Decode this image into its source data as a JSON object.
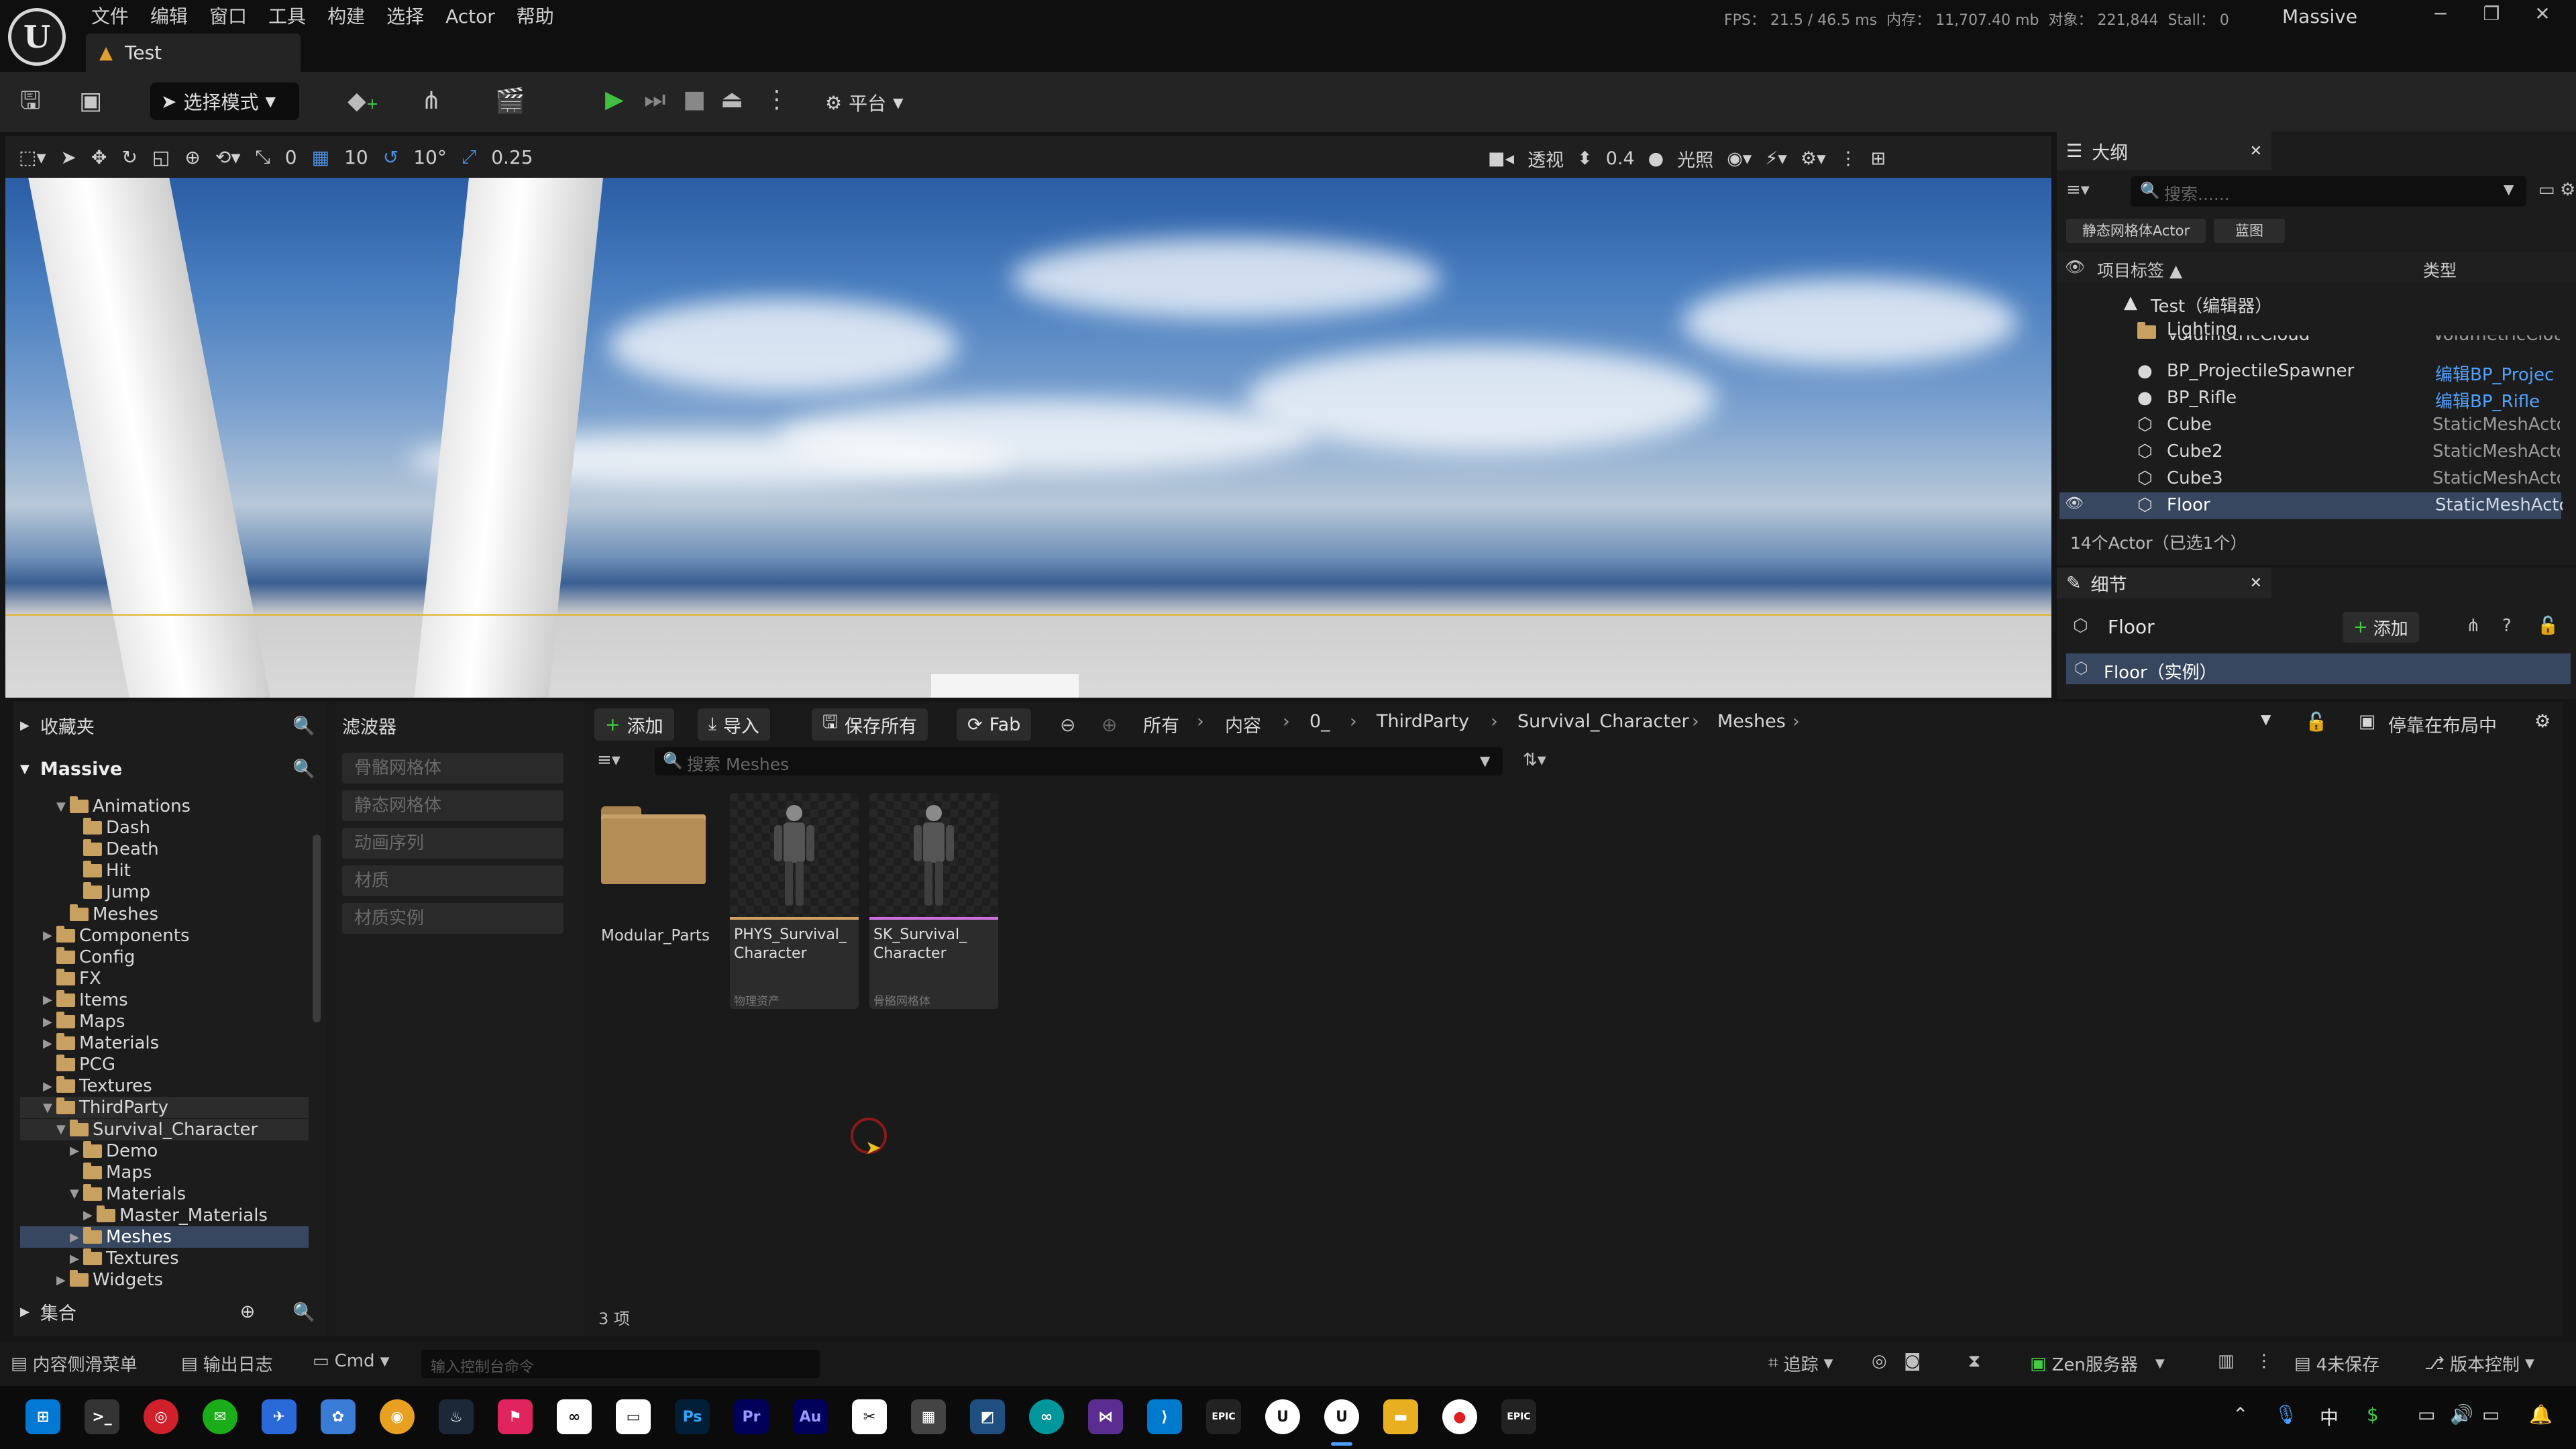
{
  "menu": [
    "文件",
    "编辑",
    "窗口",
    "工具",
    "构建",
    "选择",
    "Actor",
    "帮助"
  ],
  "stats": {
    "fps_label": "FPS：",
    "fps": "21.5",
    "ms": "/ 46.5 ms",
    "mem_label": "内存：",
    "mem": "11,707.40 mb",
    "obj_label": "对象：",
    "obj": "221,844",
    "stall_label": "Stall：",
    "stall": "0"
  },
  "project_name": "Massive",
  "doc_tab": "Test",
  "toolbar": {
    "mode": "选择模式",
    "platform": "平台"
  },
  "vp_toolbar": {
    "snap_move": "0",
    "grid": "10",
    "rot": "10°",
    "scale": "0.25",
    "view": "透视",
    "cam_speed": "0.4",
    "lit": "光照"
  },
  "outliner": {
    "title": "大纲",
    "search_placeholder": "搜索......",
    "filter_chips": [
      "静态网格体Actor",
      "蓝图"
    ],
    "col_label": "项目标签 ▲",
    "col_type": "类型",
    "rows": [
      {
        "name": "Test（编辑器）",
        "type": ""
      },
      {
        "name": "Lighting",
        "type": ""
      },
      {
        "name": "VolumetricCloud",
        "type": "VolumetricCloud"
      },
      {
        "name": "BP_ProjectileSpawner",
        "type": "编辑BP_Projec"
      },
      {
        "name": "BP_Rifle",
        "type": "编辑BP_Rifle"
      },
      {
        "name": "Cube",
        "type": "StaticMeshActo"
      },
      {
        "name": "Cube2",
        "type": "StaticMeshActo"
      },
      {
        "name": "Cube3",
        "type": "StaticMeshActo"
      },
      {
        "name": "Floor",
        "type": "StaticMeshActo"
      }
    ],
    "footer": "14个Actor（已选1个）"
  },
  "details": {
    "title": "细节",
    "actor": "Floor",
    "add": "添加",
    "instance": "Floor（实例）"
  },
  "sources": {
    "favorites": "收藏夹",
    "project": "Massive",
    "tree": [
      {
        "label": "Animations",
        "depth": 2,
        "arrow": "▼"
      },
      {
        "label": "Dash",
        "depth": 3,
        "arrow": ""
      },
      {
        "label": "Death",
        "depth": 3,
        "arrow": ""
      },
      {
        "label": "Hit",
        "depth": 3,
        "arrow": ""
      },
      {
        "label": "Jump",
        "depth": 3,
        "arrow": ""
      },
      {
        "label": "Meshes",
        "depth": 2,
        "arrow": ""
      },
      {
        "label": "Components",
        "depth": 1,
        "arrow": "▶"
      },
      {
        "label": "Config",
        "depth": 1,
        "arrow": ""
      },
      {
        "label": "FX",
        "depth": 1,
        "arrow": ""
      },
      {
        "label": "Items",
        "depth": 1,
        "arrow": "▶"
      },
      {
        "label": "Maps",
        "depth": 1,
        "arrow": "▶"
      },
      {
        "label": "Materials",
        "depth": 1,
        "arrow": "▶"
      },
      {
        "label": "PCG",
        "depth": 1,
        "arrow": ""
      },
      {
        "label": "Textures",
        "depth": 1,
        "arrow": "▶"
      },
      {
        "label": "ThirdParty",
        "depth": 1,
        "arrow": "▼"
      },
      {
        "label": "Survival_Character",
        "depth": 2,
        "arrow": "▼"
      },
      {
        "label": "Demo",
        "depth": 3,
        "arrow": "▶"
      },
      {
        "label": "Maps",
        "depth": 3,
        "arrow": ""
      },
      {
        "label": "Materials",
        "depth": 3,
        "arrow": "▼"
      },
      {
        "label": "Master_Materials",
        "depth": 4,
        "arrow": "▶"
      },
      {
        "label": "Meshes",
        "depth": 3,
        "arrow": "▶"
      },
      {
        "label": "Textures",
        "depth": 3,
        "arrow": "▶"
      },
      {
        "label": "Widgets",
        "depth": 2,
        "arrow": "▶"
      }
    ],
    "collections": "集合"
  },
  "filters": {
    "title": "滤波器",
    "items": [
      "骨骼网格体",
      "静态网格体",
      "动画序列",
      "材质",
      "材质实例"
    ]
  },
  "assets": {
    "add": "添加",
    "import": "导入",
    "save_all": "保存所有",
    "fab": "Fab",
    "crumbs": [
      "所有",
      "内容",
      "0_",
      "ThirdParty",
      "Survival_Character",
      "Meshes"
    ],
    "dock": "停靠在布局中",
    "search_placeholder": "搜索 Meshes",
    "folder_name": "Modular_Parts",
    "tiles": [
      {
        "name": "PHYS_Survival_ Character",
        "kind": "物理资产",
        "bar": "#d0a060"
      },
      {
        "name": "SK_Survival_ Character",
        "kind": "骨骼网格体",
        "bar": "#d070e0"
      }
    ],
    "count": "3 项"
  },
  "statusbar": {
    "drawer": "内容侧滑菜单",
    "log": "输出日志",
    "cmd": "Cmd",
    "console_placeholder": "输入控制台命令",
    "trace": "追踪",
    "zen": "Zen服务器",
    "unsaved": "4未保存",
    "vcs": "版本控制"
  },
  "tray": {
    "ime": "中"
  }
}
